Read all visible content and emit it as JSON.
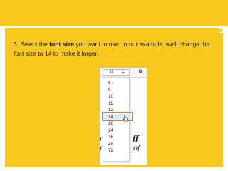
{
  "slide": {
    "instruction": {
      "part1": "3. Select the ",
      "bold": "font size",
      "part2": " you want to use. In our example, we'll change the font size to 14 to make it larger."
    },
    "colors": {
      "background": "#f8c81e",
      "highlight": "#e07a2e",
      "text": "#1a1a1a"
    }
  },
  "screenshot": {
    "toolbar": {
      "font_size_value": "11",
      "bold_label": "B"
    },
    "font_sizes": [
      "8",
      "9",
      "10",
      "11",
      "12",
      "14",
      "18",
      "24",
      "36",
      "48",
      "72"
    ],
    "selected_size": "14",
    "background_text": {
      "line1_left": "ru",
      "line1_right": "ff",
      "line2_left": "io",
      "line2_right": "of"
    },
    "icons": [
      "chevron-down-icon",
      "hand-cursor-icon"
    ]
  }
}
